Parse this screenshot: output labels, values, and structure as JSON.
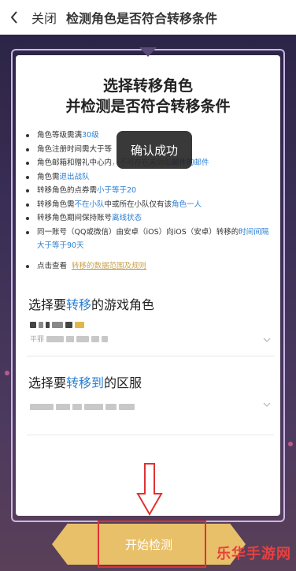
{
  "nav": {
    "close_label": "关闭",
    "title": "检测角色是否符合转移条件"
  },
  "card": {
    "title_line1": "选择转移角色",
    "title_line2": "并检测是否符合转移条件"
  },
  "rules": [
    {
      "parts": [
        {
          "t": "角色等级需满"
        },
        {
          "t": "30级",
          "c": "hl"
        }
      ]
    },
    {
      "parts": [
        {
          "t": "角色注册时间需大于等"
        }
      ]
    },
    {
      "parts": [
        {
          "t": "角色邮箱和赠礼中心内"
        },
        {
          "t": "，不可存在未领取",
          "c": "faded"
        },
        {
          "t": "邮件的邮件",
          "c": "hl"
        }
      ]
    },
    {
      "parts": [
        {
          "t": "角色需"
        },
        {
          "t": "退出战队",
          "c": "hl"
        }
      ]
    },
    {
      "parts": [
        {
          "t": "转移角色的点券需"
        },
        {
          "t": "小于等于20",
          "c": "hl"
        }
      ]
    },
    {
      "parts": [
        {
          "t": "转移角色需"
        },
        {
          "t": "不在小队",
          "c": "hl"
        },
        {
          "t": "中或所在小队仅有该"
        },
        {
          "t": "角色一人",
          "c": "hl"
        }
      ]
    },
    {
      "parts": [
        {
          "t": "转移角色期间保持账号"
        },
        {
          "t": "离线状态",
          "c": "hl"
        }
      ]
    },
    {
      "parts": [
        {
          "t": "同一账号（QQ或微信）由安卓（iOS）向iOS（安卓）转移的"
        },
        {
          "t": "时间间隔大于等于90天",
          "c": "hl"
        }
      ]
    }
  ],
  "rules_link": {
    "prefix": "点击查看",
    "link": "转移的数据范围及规则"
  },
  "toast": "确认成功",
  "section1": {
    "pre": "选择要",
    "hl": "转移",
    "post": "的游戏角色",
    "sub": "平罪"
  },
  "section2": {
    "pre": "选择要",
    "hl": "转移到",
    "post": "的区服"
  },
  "start_button": "开始检测",
  "watermark": "乐华手游网",
  "colors": {
    "accent": "#2b7fd3",
    "button": "#e8c06a",
    "highlight_box": "#e03232"
  }
}
